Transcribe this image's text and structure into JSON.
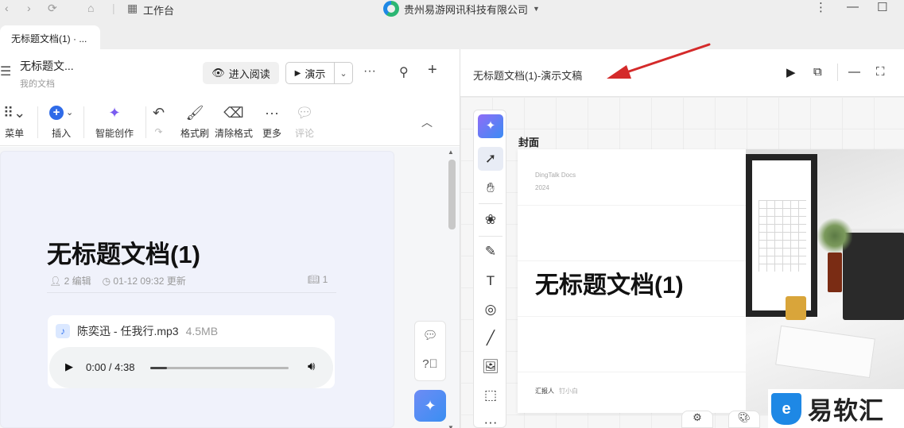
{
  "titlebar": {
    "workbench_label": "工作台",
    "company": "贵州易游网讯科技有限公司"
  },
  "tab": {
    "label": "无标题文档(1) · ..."
  },
  "doc_header": {
    "title": "无标题文...",
    "subtitle": "我的文档",
    "read_button": "进入阅读",
    "present_button": "演示"
  },
  "toolbar": {
    "menu": "菜单",
    "insert": "插入",
    "smart_create": "智能创作",
    "format_brush": "格式刷",
    "clear_format": "清除格式",
    "more": "更多",
    "comment": "评论"
  },
  "document": {
    "heading": "无标题文档(1)",
    "editors": "2 编辑",
    "updated": "01-12 09:32 更新",
    "book_count": "1",
    "audio": {
      "name": "陈奕迅 - 任我行.mp3",
      "size": "4.5MB",
      "time": "0:00 / 4:38",
      "progress": 0.12
    }
  },
  "presentation": {
    "title": "无标题文档(1)-演示文稿",
    "cover_label": "封面",
    "slide": {
      "brand": "DingTalk Docs",
      "year": "2024",
      "title": "无标题文档(1)",
      "reporter_label": "汇报人",
      "reporter_name": "钉小白"
    }
  },
  "watermark": {
    "text": "易软汇",
    "logo_letter": "e"
  },
  "colors": {
    "accent": "#2f6be8",
    "arrow": "#d42a2a",
    "ai_gradient_start": "#8f6cf7"
  }
}
